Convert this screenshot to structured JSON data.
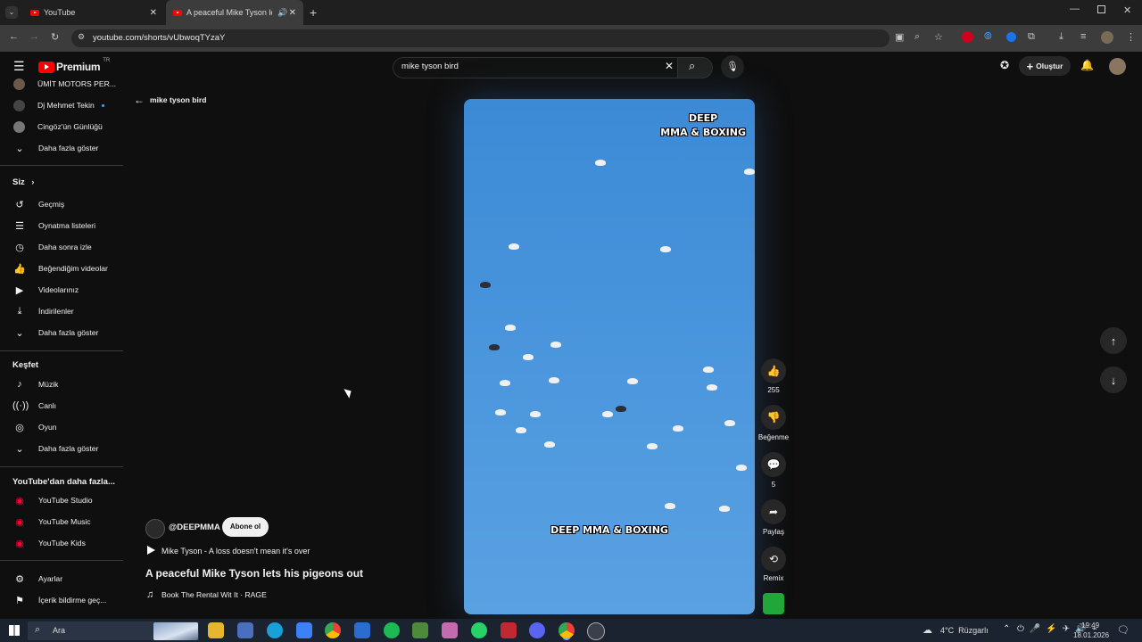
{
  "browser": {
    "tabs": [
      {
        "title": "YouTube"
      },
      {
        "title": "A peaceful Mike Tyson lets"
      }
    ],
    "url": "youtube.com/shorts/vUbwoqTYzaY"
  },
  "header": {
    "logo_text": "Premium",
    "logo_badge": "TR",
    "search_value": "mike tyson bird",
    "create_label": "Oluştur"
  },
  "sidebar": {
    "subscriptions": [
      {
        "label": "ÜMİT MOTORS PER..."
      },
      {
        "label": "Dj Mehmet Tekin"
      },
      {
        "label": "Cingöz'ün Günlüğü"
      }
    ],
    "show_more_1": "Daha fazla göster",
    "you_heading": "Siz",
    "you_items": [
      {
        "label": "Geçmiş",
        "icon": "history-icon"
      },
      {
        "label": "Oynatma listeleri",
        "icon": "playlist-icon"
      },
      {
        "label": "Daha sonra izle",
        "icon": "clock-icon"
      },
      {
        "label": "Beğendiğim videolar",
        "icon": "thumb-up-icon"
      },
      {
        "label": "Videolarınız",
        "icon": "video-icon"
      },
      {
        "label": "İndirilenler",
        "icon": "download-icon"
      }
    ],
    "show_more_2": "Daha fazla göster",
    "explore_heading": "Keşfet",
    "explore_items": [
      {
        "label": "Müzik",
        "icon": "music-icon"
      },
      {
        "label": "Canlı",
        "icon": "live-icon"
      },
      {
        "label": "Oyun",
        "icon": "game-icon"
      }
    ],
    "show_more_3": "Daha fazla göster",
    "more_heading": "YouTube'dan daha fazla...",
    "more_items": [
      {
        "label": "YouTube Studio"
      },
      {
        "label": "YouTube Music"
      },
      {
        "label": "YouTube Kids"
      }
    ],
    "settings_items": [
      {
        "label": "Ayarlar",
        "icon": "gear-icon"
      },
      {
        "label": "İçerik bildirme geç...",
        "icon": "flag-icon"
      }
    ]
  },
  "shorts": {
    "back_label": "mike tyson bird",
    "channel_handle": "@DEEPMMA",
    "subscribe_label": "Abone ol",
    "music_line": "Mike Tyson - A loss doesn't mean it's over",
    "title": "A peaceful Mike Tyson lets his pigeons out",
    "sound_line": "Book The Rental Wit It · RAGE",
    "overlay_top_line1": "DEEP",
    "overlay_top_line2": "MMA & BOXING",
    "overlay_bottom": "DEEP MMA & BOXING",
    "likes": "255",
    "dislike_label": "Beğenme",
    "comments": "5",
    "share_label": "Paylaş",
    "remix_label": "Remix"
  },
  "taskbar": {
    "search_label": "Ara",
    "weather": "4°C  Rüzgarlı",
    "time": "19:49",
    "date": "18.01.2026"
  }
}
